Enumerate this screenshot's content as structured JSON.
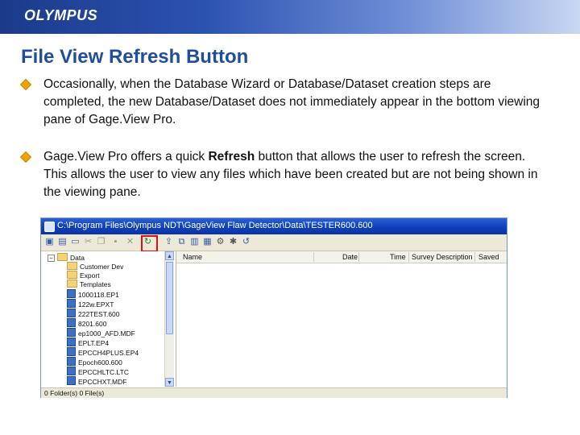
{
  "header": {
    "logo": "OLYMPUS"
  },
  "slide": {
    "title": "File View Refresh Button",
    "bullets": [
      {
        "text": "Occasionally, when the Database Wizard or Database/Dataset creation steps are completed, the new Database/Dataset does not immediately appear in the bottom viewing pane of Gage.View Pro."
      },
      {
        "pre": "Gage.View Pro offers a quick ",
        "bold": "Refresh",
        "post": " button that allows the user to refresh the screen.  This allows the user to view any files which have been created but are not being shown in the viewing pane."
      }
    ]
  },
  "window": {
    "title": "C:\\Program Files\\Olympus NDT\\GageView Flaw Detector\\Data\\TESTER600.600",
    "toolbar_icons": [
      "database-icon",
      "save-icon",
      "folder-icon",
      "cut-icon",
      "copy-icon",
      "disk-icon",
      "delete-icon",
      "refresh-icon",
      "folder-up-icon",
      "copy-files-icon",
      "paste-icon",
      "grid-icon",
      "settings-icon",
      "tools-icon",
      "undo-icon"
    ],
    "tree": {
      "root": "Data",
      "folders": [
        "Customer Dev",
        "Export",
        "Templates"
      ],
      "files": [
        "1000118.EP1",
        "122w.EPXT",
        "222TEST.600",
        "8201.600",
        "ep1000_AFD.MDF",
        "EPLT.EP4",
        "EPCCH4PLUS.EP4",
        "Epoch600.600",
        "EPCCHLTC.LTC",
        "EPCCHXT.MDF"
      ]
    },
    "columns": [
      "Name",
      "Date",
      "Time",
      "Survey Description",
      "Saved"
    ],
    "status": "0 Folder(s) 0 File(s)"
  },
  "colors": {
    "title": "#1f4e9a",
    "bullet": "#f0a400",
    "highlight_box": "#e01010"
  }
}
